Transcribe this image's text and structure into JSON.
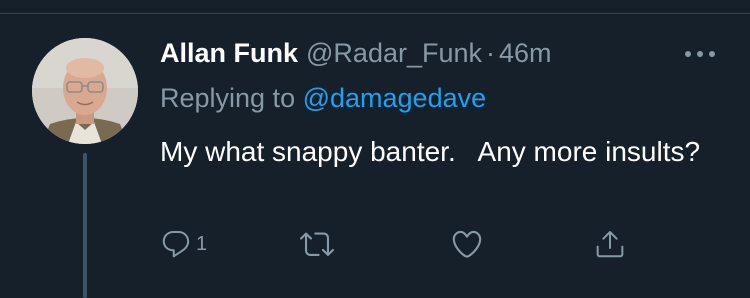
{
  "tweet": {
    "author_name": "Allan Funk",
    "author_handle": "@Radar_Funk",
    "separator": "·",
    "timestamp": "46m",
    "replying_prefix": "Replying to ",
    "replying_to": "@damagedave",
    "text": "My what snappy banter.   Any more insults?"
  },
  "actions": {
    "reply_count": "1",
    "reply_icon": "reply-icon",
    "retweet_icon": "retweet-icon",
    "like_icon": "heart-icon",
    "share_icon": "share-icon"
  },
  "colors": {
    "background": "#15202b",
    "text_primary": "#ffffff",
    "text_secondary": "#8899a6",
    "accent": "#1da1f2",
    "thread_line": "#3d5466"
  }
}
